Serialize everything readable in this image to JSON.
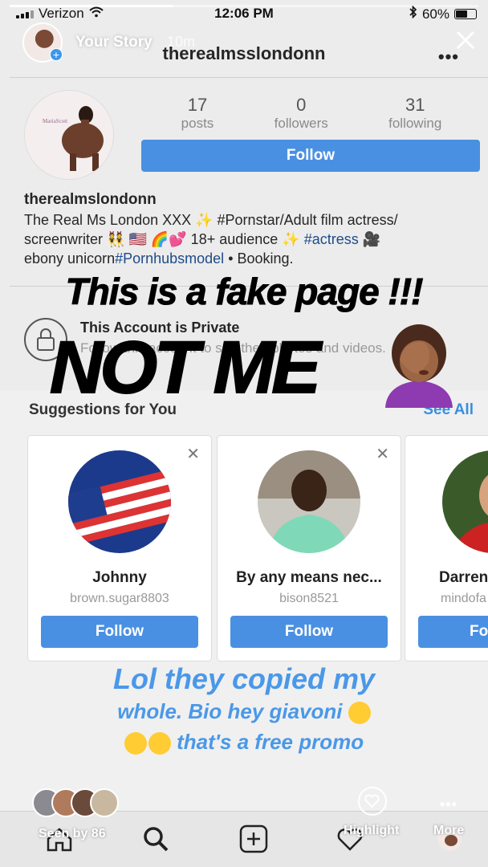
{
  "status_bar": {
    "carrier": "Verizon",
    "time": "12:06 PM",
    "battery": "60%",
    "battery_level": 0.6
  },
  "story": {
    "label": "Your Story",
    "time_ago": "10m",
    "progress": 0.35
  },
  "profile": {
    "username": "therealmsslondonn",
    "stats": [
      {
        "value": "17",
        "label": "posts"
      },
      {
        "value": "0",
        "label": "followers"
      },
      {
        "value": "31",
        "label": "following"
      }
    ],
    "follow_label": "Follow",
    "bio_name": "therealmslondonn",
    "bio_line_1": "The Real Ms London XXX ✨ #Pornstar/Adult film actress/",
    "bio_line_2a": "screenwriter 👯 🇺🇸 🌈💕 18+ audience ✨ ",
    "bio_hashtag_actress": "#actress",
    "bio_line_2b": " 🎥",
    "bio_line_3a": "ebony unicorn",
    "bio_hashtag_pornhub": "#Pornhubsmodel",
    "bio_line_3b": " • Booking.",
    "private_title": "This Account is Private",
    "private_sub": "Follow this account to see their photos and videos."
  },
  "overlay": {
    "fake_text": "This is a fake page !!!",
    "notme_text": "NOT ME"
  },
  "suggestions": {
    "title": "Suggestions for You",
    "see_all": "See All",
    "cards": [
      {
        "name": "Johnny",
        "handle": "brown.sugar8803",
        "follow": "Follow"
      },
      {
        "name": "By any means nec...",
        "handle": "bison8521",
        "follow": "Follow"
      },
      {
        "name": "Darren",
        "handle": "mindofa",
        "follow": "Fo"
      }
    ]
  },
  "caption": {
    "line_1": "Lol they copied my",
    "line_2": "whole. Bio hey giavoni",
    "line_3": " that's a free promo"
  },
  "bottom": {
    "seen_by": "Seen by 86",
    "highlight": "Highlight",
    "more": "More"
  },
  "colors": {
    "accent": "#4a90e2",
    "caption": "#4a98e8"
  }
}
